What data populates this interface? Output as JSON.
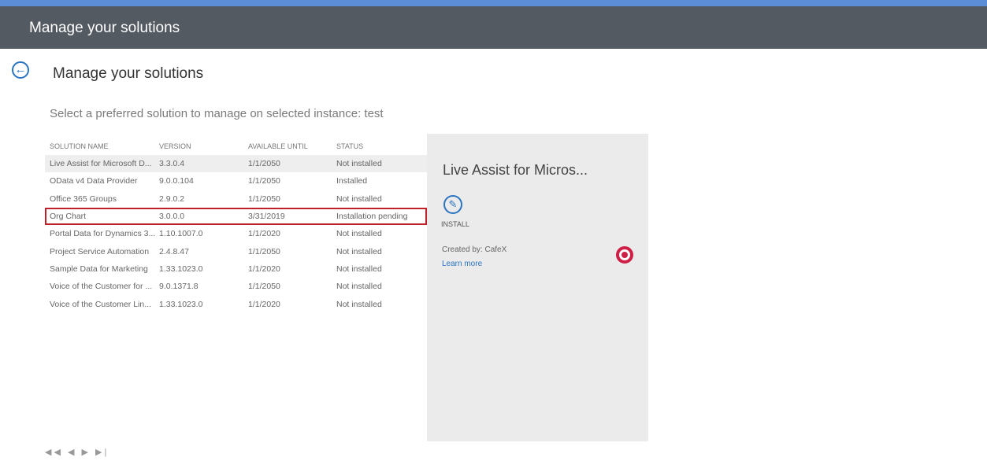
{
  "window": {
    "title": "Manage your solutions"
  },
  "page": {
    "heading": "Manage your solutions",
    "subheading": "Select a preferred solution to manage on selected instance: test"
  },
  "table": {
    "headers": [
      "SOLUTION NAME",
      "VERSION",
      "AVAILABLE UNTIL",
      "STATUS"
    ],
    "rows": [
      {
        "name": "Live Assist for Microsoft D...",
        "version": "3.3.0.4",
        "available": "1/1/2050",
        "status": "Not installed"
      },
      {
        "name": "OData v4 Data Provider",
        "version": "9.0.0.104",
        "available": "1/1/2050",
        "status": "Installed"
      },
      {
        "name": "Office 365 Groups",
        "version": "2.9.0.2",
        "available": "1/1/2050",
        "status": "Not installed"
      },
      {
        "name": "Org Chart",
        "version": "3.0.0.0",
        "available": "3/31/2019",
        "status": "Installation pending"
      },
      {
        "name": "Portal Data for Dynamics 3...",
        "version": "1.10.1007.0",
        "available": "1/1/2020",
        "status": "Not installed"
      },
      {
        "name": "Project Service Automation",
        "version": "2.4.8.47",
        "available": "1/1/2050",
        "status": "Not installed"
      },
      {
        "name": "Sample Data for Marketing",
        "version": "1.33.1023.0",
        "available": "1/1/2020",
        "status": "Not installed"
      },
      {
        "name": "Voice of the Customer for ...",
        "version": "9.0.1371.8",
        "available": "1/1/2050",
        "status": "Not installed"
      },
      {
        "name": "Voice of the Customer Lin...",
        "version": "1.33.1023.0",
        "available": "1/1/2020",
        "status": "Not installed"
      }
    ]
  },
  "detail": {
    "title": "Live Assist for Micros...",
    "install_label": "INSTALL",
    "created_by": "Created by: CafeX",
    "learn_more": "Learn more"
  },
  "icons": {
    "back": "back-arrow-icon",
    "install": "pencil-icon",
    "help": "lifebuoy-icon"
  },
  "colors": {
    "accent": "#5b8ed6",
    "titlebar": "#545a62",
    "link": "#2a74c2",
    "highlight": "#c0202a"
  }
}
